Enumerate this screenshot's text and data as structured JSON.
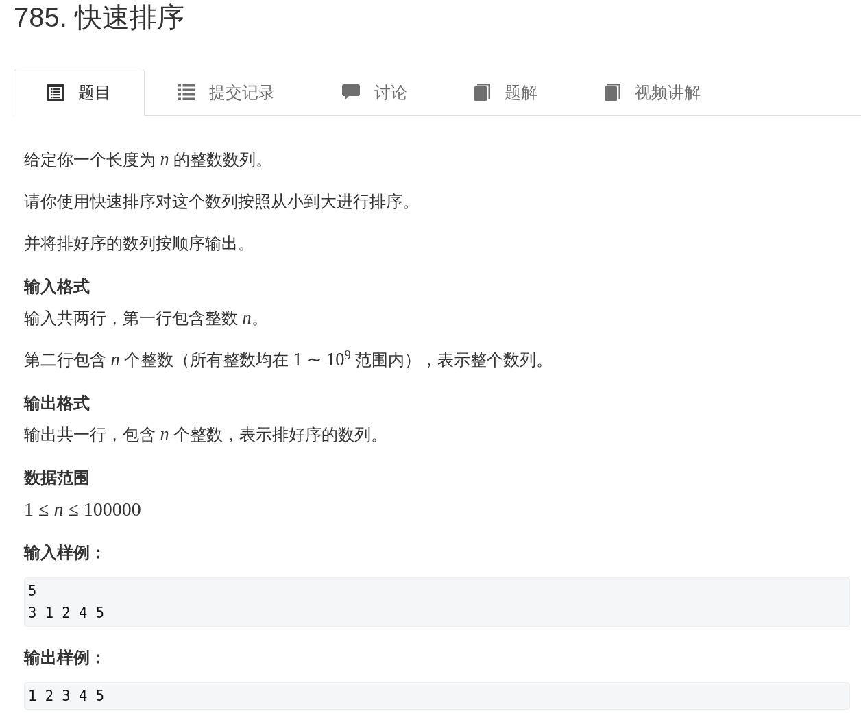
{
  "title": "785. 快速排序",
  "tabs": [
    {
      "label": "题目",
      "kind": "statement",
      "selected": true
    },
    {
      "label": "提交记录",
      "kind": "submissions",
      "selected": false
    },
    {
      "label": "讨论",
      "kind": "discussion",
      "selected": false
    },
    {
      "label": "题解",
      "kind": "solutions",
      "selected": false
    },
    {
      "label": "视频讲解",
      "kind": "videos",
      "selected": false
    }
  ],
  "content": [
    {
      "kind": "paragraph",
      "runs": [
        {
          "text": "给定你一个长度为 ",
          "math": false
        },
        {
          "text": "*n*",
          "math": true
        },
        {
          "text": " 的整数数列。",
          "math": false
        }
      ]
    },
    {
      "kind": "paragraph",
      "runs": [
        {
          "text": "请你使用快速排序对这个数列按照从小到大进行排序。",
          "math": false
        }
      ]
    },
    {
      "kind": "paragraph",
      "runs": [
        {
          "text": "并将排好序的数列按顺序输出。",
          "math": false
        }
      ]
    },
    {
      "kind": "heading",
      "text": "输入格式"
    },
    {
      "kind": "paragraph",
      "runs": [
        {
          "text": "输入共两行，第一行包含整数 ",
          "math": false
        },
        {
          "text": "*n*",
          "math": true
        },
        {
          "text": "。",
          "math": false
        }
      ]
    },
    {
      "kind": "paragraph",
      "runs": [
        {
          "text": "第二行包含 ",
          "math": false
        },
        {
          "text": "*n*",
          "math": true
        },
        {
          "text": " 个整数（所有整数均在 ",
          "math": false
        },
        {
          "text": "1 ∼ 10$^{9}$",
          "math": true
        },
        {
          "text": " 范围内），表示整个数列。",
          "math": false
        }
      ]
    },
    {
      "kind": "heading",
      "text": "输出格式"
    },
    {
      "kind": "paragraph",
      "runs": [
        {
          "text": "输出共一行，包含 ",
          "math": false
        },
        {
          "text": "*n*",
          "math": true
        },
        {
          "text": " 个整数，表示排好序的数列。",
          "math": false
        }
      ]
    },
    {
      "kind": "heading",
      "text": "数据范围"
    },
    {
      "kind": "formula",
      "runs": [
        {
          "text": "1 ≤ *n* ≤ 100000",
          "math": true
        }
      ]
    },
    {
      "kind": "heading",
      "text": "输入样例："
    },
    {
      "kind": "code",
      "text": "5\n3 1 2 4 5"
    },
    {
      "kind": "heading",
      "text": "输出样例："
    },
    {
      "kind": "code",
      "text": "1 2 3 4 5"
    }
  ]
}
